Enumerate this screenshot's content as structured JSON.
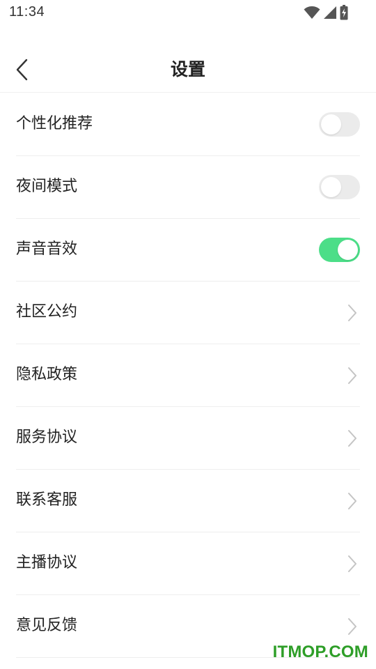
{
  "status_bar": {
    "time": "11:34",
    "icons": [
      "wifi-icon",
      "signal-icon",
      "battery-charging-icon"
    ]
  },
  "header": {
    "title": "设置",
    "back_icon": "chevron-left-icon"
  },
  "settings": {
    "items": [
      {
        "label": "个性化推荐",
        "control": "toggle",
        "checked": false
      },
      {
        "label": "夜间模式",
        "control": "toggle",
        "checked": false
      },
      {
        "label": "声音音效",
        "control": "toggle",
        "checked": true
      },
      {
        "label": "社区公约",
        "control": "chevron"
      },
      {
        "label": "隐私政策",
        "control": "chevron"
      },
      {
        "label": "服务协议",
        "control": "chevron"
      },
      {
        "label": "联系客服",
        "control": "chevron"
      },
      {
        "label": "主播协议",
        "control": "chevron"
      },
      {
        "label": "意见反馈",
        "control": "chevron"
      }
    ]
  },
  "colors": {
    "toggle_on": "#4cde88",
    "toggle_off": "#ebebeb",
    "watermark": "#2e9e28"
  },
  "watermark": "ITMOP.COM"
}
